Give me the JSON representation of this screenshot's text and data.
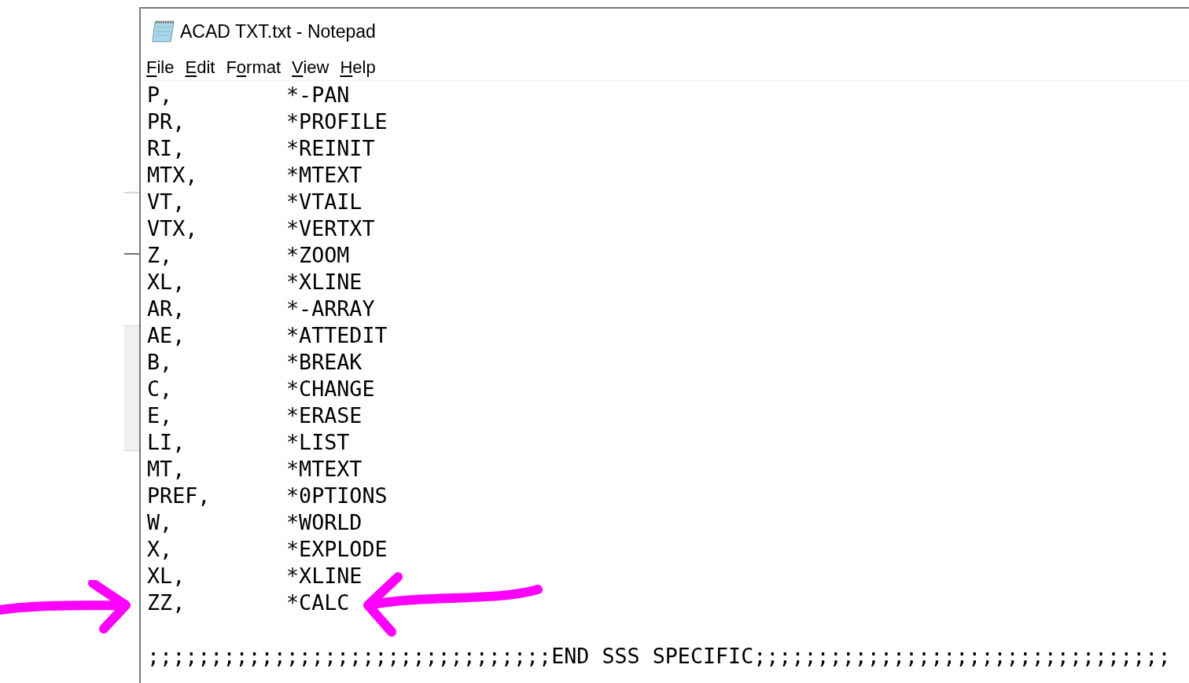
{
  "window": {
    "title": "ACAD TXT.txt - Notepad"
  },
  "menu": [
    {
      "access_key": "F",
      "rest": "ile"
    },
    {
      "access_key": "E",
      "rest": "dit"
    },
    {
      "lead": "F",
      "access_key": "o",
      "rest": "rmat"
    },
    {
      "access_key": "V",
      "rest": "iew"
    },
    {
      "access_key": "H",
      "rest": "elp"
    }
  ],
  "lines": [
    {
      "alias": "P,",
      "command": "*-PAN"
    },
    {
      "alias": "PR,",
      "command": "*PROFILE"
    },
    {
      "alias": "RI,",
      "command": "*REINIT"
    },
    {
      "alias": "MTX,",
      "command": "*MTEXT"
    },
    {
      "alias": "VT,",
      "command": "*VTAIL"
    },
    {
      "alias": "VTX,",
      "command": "*VERTXT"
    },
    {
      "alias": "Z,",
      "command": "*ZOOM"
    },
    {
      "alias": "XL,",
      "command": "*XLINE"
    },
    {
      "alias": "AR,",
      "command": "*-ARRAY"
    },
    {
      "alias": "AE,",
      "command": "*ATTEDIT"
    },
    {
      "alias": "B,",
      "command": "*BREAK"
    },
    {
      "alias": "C,",
      "command": "*CHANGE"
    },
    {
      "alias": "E,",
      "command": "*ERASE"
    },
    {
      "alias": "LI,",
      "command": "*LIST"
    },
    {
      "alias": "MT,",
      "command": "*MTEXT"
    },
    {
      "alias": "PREF,",
      "command": "*0PTIONS"
    },
    {
      "alias": "W,",
      "command": "*WORLD"
    },
    {
      "alias": "X,",
      "command": "*EXPLODE"
    },
    {
      "alias": "XL,",
      "command": "*XLINE"
    },
    {
      "alias": "ZZ,",
      "command": "*CALC"
    }
  ],
  "footer_line": ";;;;;;;;;;;;;;;;;;;;;;;;;;;;;;;;END SSS SPECIFIC;;;;;;;;;;;;;;;;;;;;;;;;;;;;;;;;;"
}
